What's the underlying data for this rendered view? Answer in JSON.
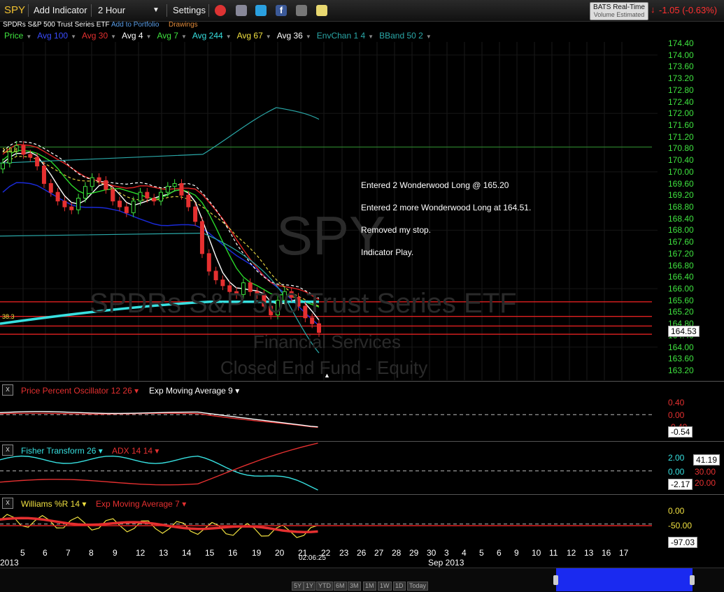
{
  "toolbar": {
    "symbol": "SPY",
    "add_indicator": "Add Indicator",
    "interval": "2 Hour",
    "settings": "Settings",
    "feed_title": "BATS Real-Time",
    "feed_sub": "Volume Estimated",
    "change": "-1.05 (-0.63%)"
  },
  "info": {
    "name": "SPDRs S&P 500 Trust Series ETF",
    "add_portfolio": "Add to Portfolio",
    "drawings": "Drawings"
  },
  "indicators": [
    {
      "label": "Price",
      "color": "#3fe33f"
    },
    {
      "label": "Avg 100",
      "color": "#3a4cff"
    },
    {
      "label": "Avg 30",
      "color": "#e53030"
    },
    {
      "label": "Avg 4",
      "color": "#ffffff"
    },
    {
      "label": "Avg 7",
      "color": "#3fe33f"
    },
    {
      "label": "Avg 244",
      "color": "#37e0e0"
    },
    {
      "label": "Avg 67",
      "color": "#f0e040"
    },
    {
      "label": "Avg 36",
      "color": "#ffffff"
    },
    {
      "label": "EnvChan 1 4",
      "color": "#2aa8a8"
    },
    {
      "label": "BBand 50 2",
      "color": "#2aa8a8"
    }
  ],
  "watermark": {
    "symbol": "SPY",
    "name": "SPDRs S&P 500 Trust Series ETF",
    "sector": "Financial Services",
    "category": "Closed End Fund - Equity"
  },
  "annotations": [
    "Entered 2 Wonderwood Long @ 165.20",
    "Entered 2 more Wonderwood Long at 164.51.",
    "Removed my stop.",
    "Indicator Play."
  ],
  "chart_data": {
    "type": "line",
    "y_ticks": [
      "174.40",
      "174.00",
      "173.60",
      "173.20",
      "172.80",
      "172.40",
      "172.00",
      "171.60",
      "171.20",
      "170.80",
      "170.40",
      "170.00",
      "169.60",
      "169.20",
      "168.80",
      "168.40",
      "168.00",
      "167.60",
      "167.20",
      "166.80",
      "166.40",
      "166.00",
      "165.60",
      "165.20",
      "164.80",
      "164.40",
      "164.00",
      "163.60",
      "163.20"
    ],
    "ylim": [
      163.0,
      174.6
    ],
    "last_price": "164.53",
    "left_markers": [
      "113.8",
      "38.3"
    ],
    "horizontal_levels": [
      170.85,
      165.55,
      165.05,
      164.72,
      164.44
    ],
    "x_ticks": [
      "5",
      "6",
      "7",
      "8",
      "9",
      "12",
      "13",
      "14",
      "15",
      "16",
      "19",
      "20",
      "21",
      "22",
      "23",
      "26",
      "27",
      "28",
      "29",
      "30",
      "3",
      "4",
      "5",
      "6",
      "9",
      "10",
      "11",
      "12",
      "13",
      "16",
      "17"
    ],
    "x_year_label": "2013",
    "x_month_label": "Sep 2013",
    "time_marker": "02:06:25",
    "candles_close": [
      170.3,
      170.7,
      170.9,
      170.6,
      170.5,
      170.2,
      169.6,
      169.3,
      169.0,
      168.8,
      168.7,
      169.1,
      169.5,
      169.8,
      169.7,
      169.4,
      169.0,
      168.8,
      168.6,
      169.0,
      169.3,
      169.1,
      169.0,
      169.3,
      169.5,
      169.6,
      169.2,
      168.8,
      168.3,
      167.2,
      166.6,
      166.3,
      166.1,
      165.9,
      165.8,
      166.2,
      165.9,
      165.8,
      165.4,
      165.1,
      165.6,
      165.9,
      165.7,
      165.4,
      165.0,
      164.8,
      164.5
    ],
    "panels": [
      {
        "name": "Price Percent Oscillator 12 26",
        "overlay": "Exp Moving Average 9",
        "ticks": [
          "0.40",
          "0.00",
          "-0.40"
        ],
        "last": "-0.54"
      },
      {
        "name": "Fisher Transform 26",
        "overlay": "ADX 14 14",
        "ticks": [
          "2.00",
          "0.00",
          "-2.00"
        ],
        "last": "-2.17",
        "last2": "41.19",
        "adx_ticks": [
          "30.00",
          "20.00"
        ]
      },
      {
        "name": "Williams %R 14",
        "overlay": "Exp Moving Average 7",
        "ticks": [
          "0.00",
          "-50.00"
        ],
        "last": "-97.03"
      }
    ]
  },
  "navigator": {
    "ranges": [
      "5Y",
      "1Y",
      "YTD",
      "6M",
      "3M",
      "1M",
      "1W",
      "1D",
      "Today"
    ]
  },
  "colors": {
    "up": "#3fe33f",
    "down": "#e53030",
    "accent_red": "#ff2a2a",
    "cyan": "#37e0e0"
  }
}
